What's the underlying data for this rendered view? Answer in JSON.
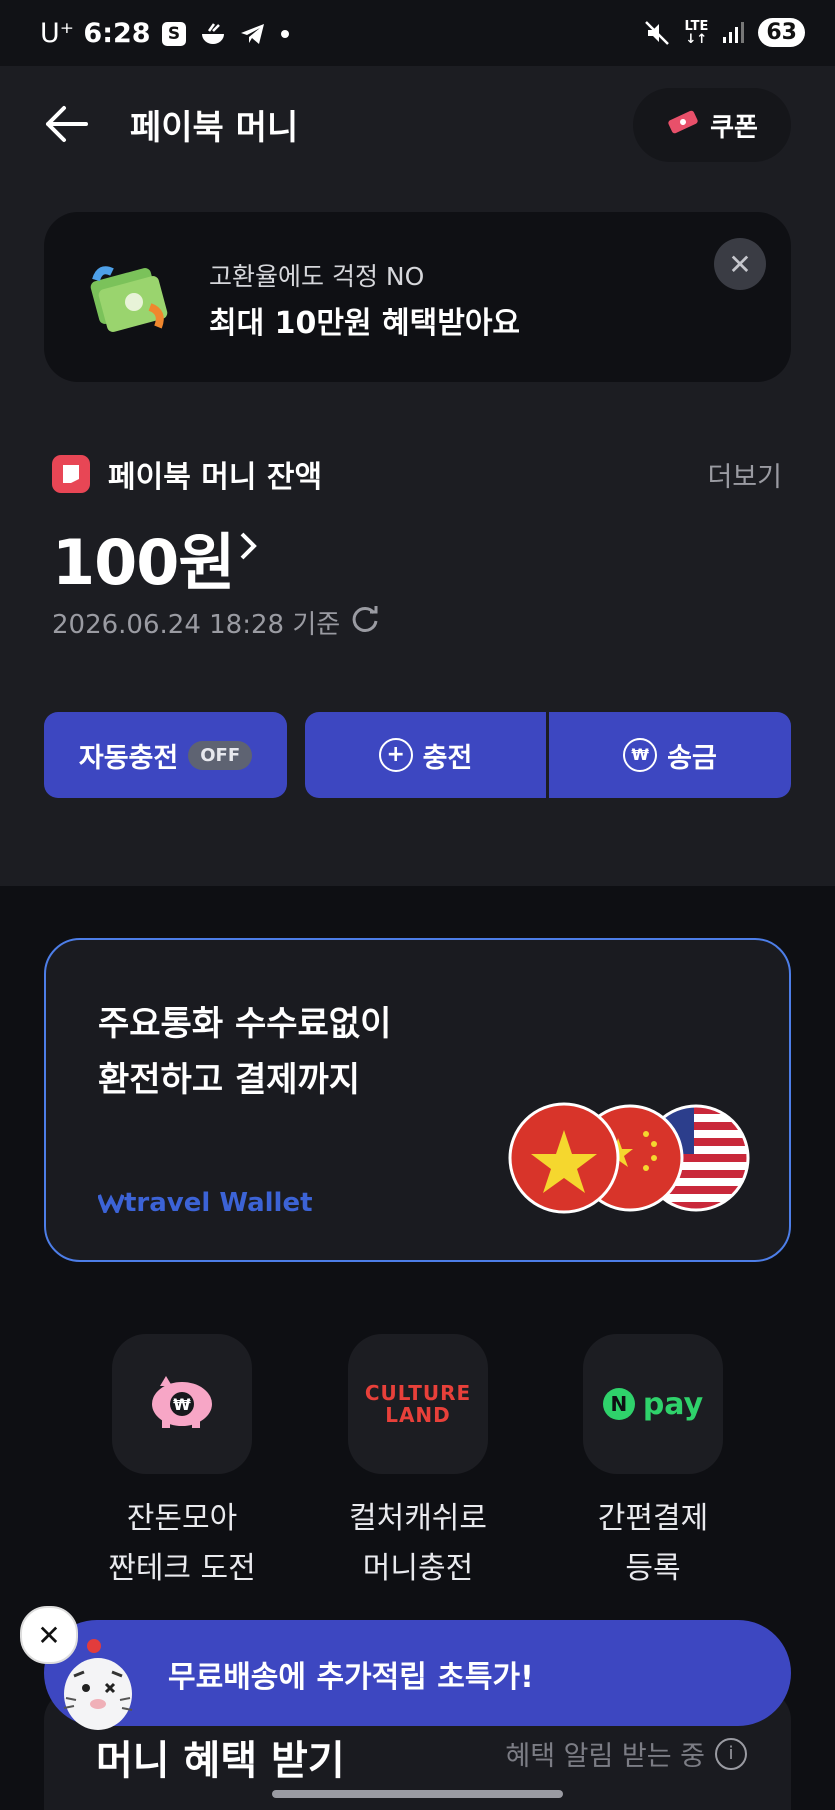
{
  "status_bar": {
    "carrier": "U⁺",
    "time": "6:28",
    "notification_s": "S",
    "network": "LTE",
    "battery": "63"
  },
  "header": {
    "title": "페이북 머니",
    "coupon_label": "쿠폰"
  },
  "banner": {
    "line1": "고환율에도 걱정 NO",
    "line2": "최대 10만원 혜택받아요"
  },
  "balance": {
    "label": "페이북 머니 잔액",
    "more": "더보기",
    "amount": "100원",
    "timestamp": "2026.06.24 18:28 기준"
  },
  "actions": {
    "auto_charge": "자동충전",
    "auto_charge_state": "OFF",
    "charge": "충전",
    "send": "송금"
  },
  "travel_wallet": {
    "line1": "주요통화 수수료없이",
    "line2": "환전하고 결제까지",
    "logo": "travel Wallet"
  },
  "quick_menu": [
    {
      "line1": "잔돈모아",
      "line2": "짠테크 도전",
      "icon": "piggy-bank-icon"
    },
    {
      "line1": "컬처캐쉬로",
      "line2": "머니충전",
      "icon": "culture-land-logo",
      "logo_top": "CULTURE",
      "logo_bottom": "LAND"
    },
    {
      "line1": "간편결제",
      "line2": "등록",
      "icon": "npay-logo",
      "logo_n": "N",
      "logo_text": "pay"
    }
  ],
  "promo": {
    "text": "무료배송에 추가적립 초특가!"
  },
  "benefit": {
    "heading": "머니 혜택 받기",
    "notice": "혜택 알림 받는 중"
  },
  "colors": {
    "accent": "#3d47c1",
    "card_border": "#4d7ee8",
    "brand_red": "#e84655"
  }
}
